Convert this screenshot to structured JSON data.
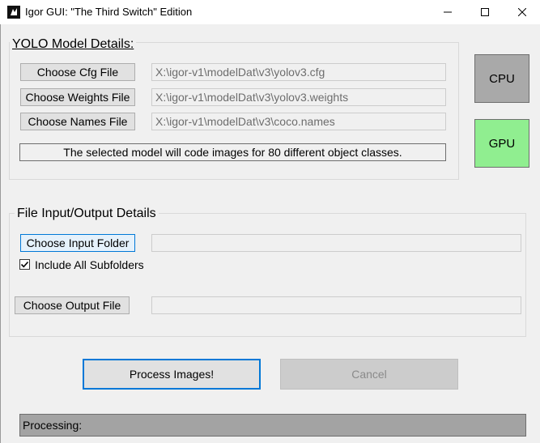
{
  "window": {
    "title": "Igor GUI: \"The Third Switch\" Edition"
  },
  "yolo_group": {
    "title": "YOLO Model Details:",
    "cfg_button": "Choose Cfg File",
    "cfg_path": "X:\\igor-v1\\modelDat\\v3\\yolov3.cfg",
    "weights_button": "Choose Weights File",
    "weights_path": "X:\\igor-v1\\modelDat\\v3\\yolov3.weights",
    "names_button": "Choose Names File",
    "names_path": "X:\\igor-v1\\modelDat\\v3\\coco.names",
    "info_text": "The selected model will code images for 80 different object classes."
  },
  "device": {
    "cpu_label": "CPU",
    "gpu_label": "GPU",
    "cpu_color": "#a9a9a9",
    "gpu_color": "#90ee90",
    "selected": "GPU"
  },
  "io_group": {
    "title": "File Input/Output Details",
    "input_button": "Choose Input Folder",
    "input_path": "",
    "include_subfolders_label": "Include All Subfolders",
    "include_subfolders_checked": true,
    "output_button": "Choose Output File",
    "output_path": ""
  },
  "actions": {
    "process_label": "Process Images!",
    "cancel_label": "Cancel"
  },
  "status": {
    "text": "Processing:"
  },
  "icons": {
    "app": "app-logo-icon",
    "minimize": "minimize-icon",
    "maximize": "maximize-icon",
    "close": "close-icon",
    "check": "checkmark-icon"
  }
}
